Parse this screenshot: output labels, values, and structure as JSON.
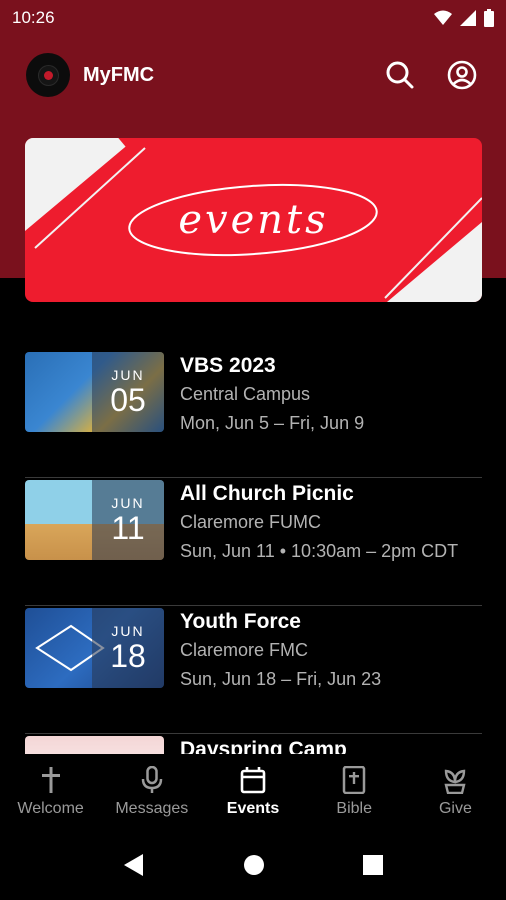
{
  "status_bar": {
    "time": "10:26"
  },
  "app": {
    "title": "MyFMC"
  },
  "banner": {
    "text": "events"
  },
  "events": [
    {
      "title": "VBS 2023",
      "location": "Central Campus",
      "when": "Mon, Jun 5 – Fri, Jun 9",
      "month": "JUN",
      "day": "05"
    },
    {
      "title": "All Church Picnic",
      "location": "Claremore FUMC",
      "when": "Sun, Jun 11 • 10:30am – 2pm CDT",
      "month": "JUN",
      "day": "11"
    },
    {
      "title": "Youth Force",
      "location": "Claremore FMC",
      "when": "Sun, Jun 18 – Fri, Jun 23",
      "month": "JUN",
      "day": "18"
    },
    {
      "title": "Dayspring Camp",
      "location": "",
      "when": "",
      "month": "",
      "day": ""
    }
  ],
  "nav": {
    "items": [
      {
        "label": "Welcome",
        "icon": "cross-icon"
      },
      {
        "label": "Messages",
        "icon": "microphone-icon"
      },
      {
        "label": "Events",
        "icon": "calendar-icon",
        "active": true
      },
      {
        "label": "Bible",
        "icon": "bible-icon"
      },
      {
        "label": "Give",
        "icon": "plant-icon"
      }
    ]
  },
  "colors": {
    "header": "#7a111d",
    "banner": "#ee1c2e",
    "background": "#000000"
  }
}
